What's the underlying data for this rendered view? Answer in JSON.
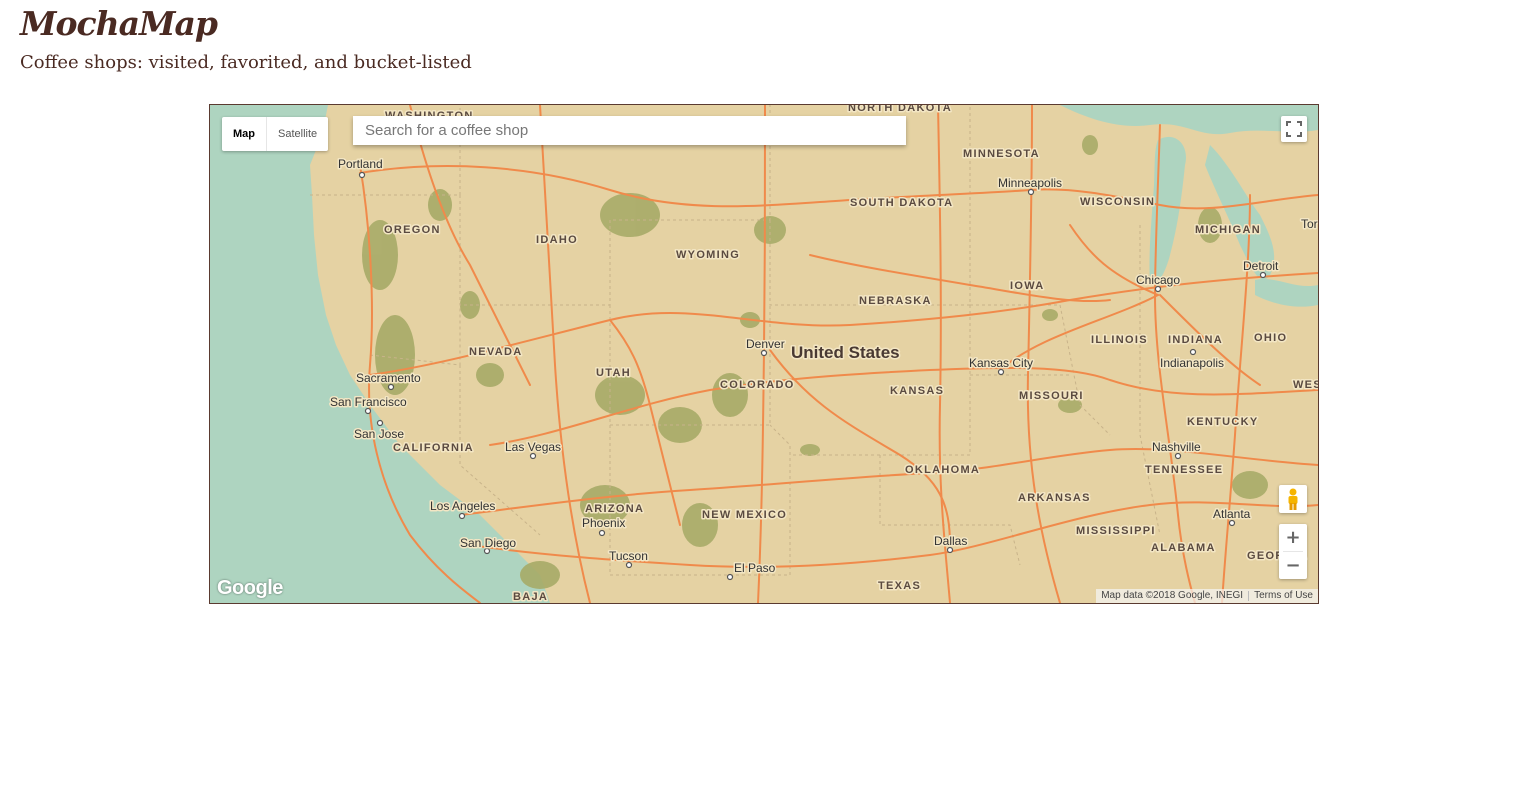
{
  "app": {
    "title": "MochaMap",
    "subtitle": "Coffee shops: visited, favorited, and bucket-listed"
  },
  "map": {
    "type_control": {
      "map_label": "Map",
      "satellite_label": "Satellite",
      "selected": "Map"
    },
    "search": {
      "placeholder": "Search for a coffee shop",
      "value": ""
    },
    "country_label": "United States",
    "states": [
      "WASHINGTON",
      "NORTH DAKOTA",
      "MINNESOTA",
      "SOUTH DAKOTA",
      "OREGON",
      "IDAHO",
      "WYOMING",
      "WISCONSIN",
      "MICHIGAN",
      "IOWA",
      "NEBRASKA",
      "NEVADA",
      "UTAH",
      "COLORADO",
      "ILLINOIS",
      "INDIANA",
      "OHIO",
      "KANSAS",
      "MISSOURI",
      "CALIFORNIA",
      "KENTUCKY",
      "OKLAHOMA",
      "TENNESSEE",
      "ARKANSAS",
      "ARIZONA",
      "NEW MEXICO",
      "MISSISSIPPI",
      "ALABAMA",
      "GEORGIA",
      "TEXAS",
      "BAJA",
      "WEST VIRGI"
    ],
    "cities": [
      "Portland",
      "Minneapolis",
      "Chicago",
      "Detroit",
      "Denver",
      "Kansas City",
      "Indianapolis",
      "Sacramento",
      "San Francisco",
      "San Jose",
      "Las Vegas",
      "Nashville",
      "Los Angeles",
      "Phoenix",
      "Atlanta",
      "San Diego",
      "Tucson",
      "El Paso",
      "Dallas",
      "Tor"
    ],
    "attribution": "Map data ©2018 Google, INEGI",
    "terms_label": "Terms of Use",
    "logo_text": "Google",
    "zoom_in_label": "+",
    "zoom_out_label": "−",
    "colors": {
      "land": "#e5d2a3",
      "water": "#aed4c0",
      "roads": "#f08a4b",
      "parks": "#a7ab68",
      "frame": "#5a3a30",
      "brand": "#4a2a22"
    }
  }
}
